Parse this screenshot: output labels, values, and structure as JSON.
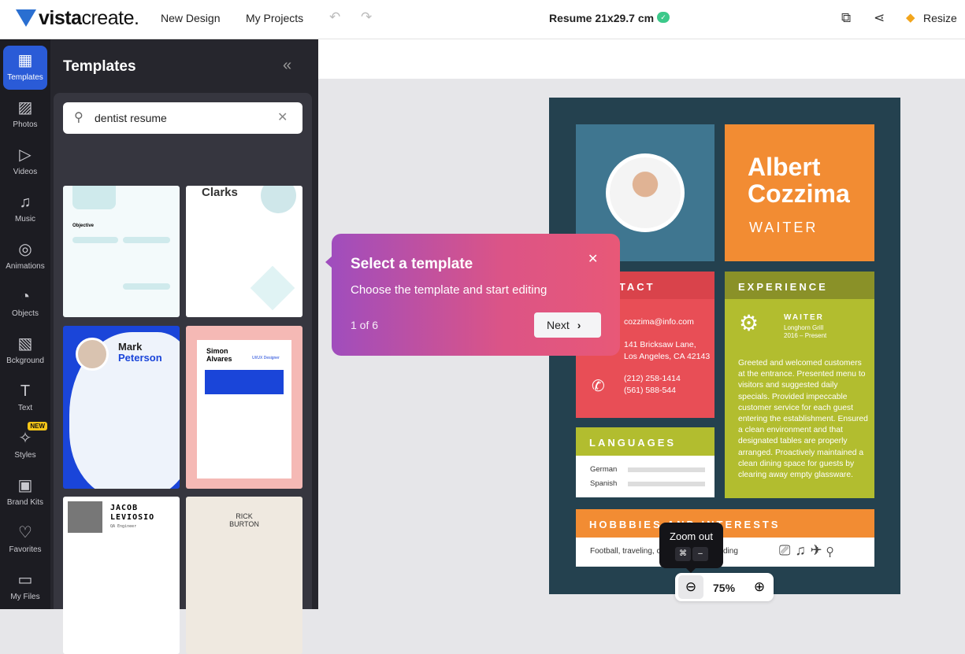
{
  "topbar": {
    "logo_bold": "vista",
    "logo_light": "create.",
    "new_design": "New Design",
    "my_projects": "My Projects",
    "doc_title": "Resume 21x29.7 cm",
    "resize": "Resize"
  },
  "rail": [
    {
      "label": "Templates",
      "icon": "templates-icon"
    },
    {
      "label": "Photos",
      "icon": "photos-icon"
    },
    {
      "label": "Videos",
      "icon": "videos-icon"
    },
    {
      "label": "Music",
      "icon": "music-icon"
    },
    {
      "label": "Animations",
      "icon": "animations-icon"
    },
    {
      "label": "Objects",
      "icon": "objects-icon"
    },
    {
      "label": "Bckground",
      "icon": "background-icon"
    },
    {
      "label": "Text",
      "icon": "text-icon"
    },
    {
      "label": "Styles",
      "icon": "styles-icon",
      "badge": "NEW"
    },
    {
      "label": "Brand Kits",
      "icon": "brand-kits-icon"
    },
    {
      "label": "Favorites",
      "icon": "favorites-icon"
    },
    {
      "label": "My Files",
      "icon": "my-files-icon"
    }
  ],
  "panel": {
    "title": "Templates",
    "search_value": "dentist resume"
  },
  "thumbs": {
    "t1": "Objective",
    "t2": "Clarks",
    "t3_first": "Mark",
    "t3_last": "Peterson",
    "t4_first": "Simon",
    "t4_last": "Alvares",
    "t4_role": "UI/UX Designer",
    "t5_first": "JACOB",
    "t5_last": "LEVIOSIO",
    "t5_role": "QA Engineer",
    "t6_first": "RICK",
    "t6_last": "BURTON"
  },
  "resume": {
    "first": "Albert",
    "last": "Cozzima",
    "role": "WAITER",
    "contact_h": "CONTACT",
    "email": "cozzima@info.com",
    "addr1": "141 Bricksaw Lane,",
    "addr2": "Los Angeles, CA 42143",
    "phone1": "(212) 258-1414",
    "phone2": "(561) 588-544",
    "exp_h": "EXPERIENCE",
    "job": "WAITER",
    "company": "Longhorn Grill",
    "dates": "2016 – Present",
    "desc": "Greeted and welcomed customers at the entrance. Presented menu to visitors and suggested daily specials. Provided impeccable customer service for each guest entering the establishment. Ensured a clean environment and that designated tables are properly arranged. Proactively maintained a clean dining space for guests by clearing away empty glassware.",
    "lang_h": "LANGUAGES",
    "lang1": "German",
    "lang2": "Spanish",
    "hob_h": "HOBBBIES AND INTERESTS",
    "hob_a": "Football, traveling, c",
    "hob_b": "ding"
  },
  "popup": {
    "title": "Select a template",
    "text": "Choose the template and start editing",
    "step": "1 of 6",
    "next": "Next"
  },
  "tooltip": {
    "title": "Zoom out",
    "key1": "⌘",
    "key2": "–"
  },
  "zoom": {
    "value": "75%"
  },
  "colors": {
    "accent": "#2a5bd7",
    "resume_bg": "#24414f",
    "orange": "#f28c33",
    "red": "#e84e56",
    "green": "#b2bd2f",
    "photo_block": "#3f7690"
  }
}
